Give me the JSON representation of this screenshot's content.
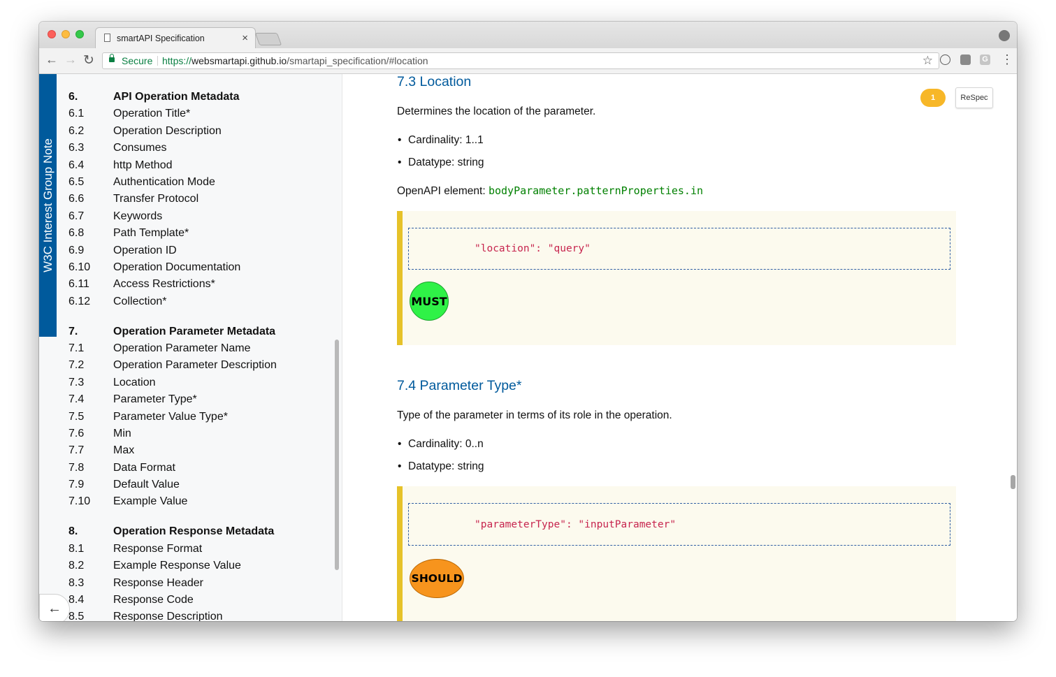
{
  "browser": {
    "tab_title": "smartAPI Specification",
    "tab_close": "×",
    "secure_label": "Secure",
    "url_scheme": "https://",
    "url_host": "websmartapi.github.io",
    "url_path": "/smartapi_specification/#location",
    "star": "☆",
    "back": "←",
    "forward": "→",
    "reload": "↻",
    "menu": "⋮",
    "ext_g": "G"
  },
  "sidebar": {
    "ribbon": "W3C Interest Group Note",
    "toggle": "←",
    "sections": [
      {
        "num": "6.",
        "label": "API Operation Metadata",
        "items": [
          {
            "num": "6.1",
            "label": "Operation Title*"
          },
          {
            "num": "6.2",
            "label": "Operation Description"
          },
          {
            "num": "6.3",
            "label": "Consumes"
          },
          {
            "num": "6.4",
            "label": "http Method"
          },
          {
            "num": "6.5",
            "label": "Authentication Mode"
          },
          {
            "num": "6.6",
            "label": "Transfer Protocol"
          },
          {
            "num": "6.7",
            "label": "Keywords"
          },
          {
            "num": "6.8",
            "label": "Path Template*"
          },
          {
            "num": "6.9",
            "label": "Operation ID"
          },
          {
            "num": "6.10",
            "label": "Operation Documentation"
          },
          {
            "num": "6.11",
            "label": "Access Restrictions*"
          },
          {
            "num": "6.12",
            "label": "Collection*"
          }
        ]
      },
      {
        "num": "7.",
        "label": "Operation Parameter Metadata",
        "items": [
          {
            "num": "7.1",
            "label": "Operation Parameter Name"
          },
          {
            "num": "7.2",
            "label": "Operation Parameter Description"
          },
          {
            "num": "7.3",
            "label": "Location"
          },
          {
            "num": "7.4",
            "label": "Parameter Type*"
          },
          {
            "num": "7.5",
            "label": "Parameter Value Type*"
          },
          {
            "num": "7.6",
            "label": "Min"
          },
          {
            "num": "7.7",
            "label": "Max"
          },
          {
            "num": "7.8",
            "label": "Data Format"
          },
          {
            "num": "7.9",
            "label": "Default Value"
          },
          {
            "num": "7.10",
            "label": "Example Value"
          }
        ]
      },
      {
        "num": "8.",
        "label": "Operation Response Metadata",
        "items": [
          {
            "num": "8.1",
            "label": "Response Format"
          },
          {
            "num": "8.2",
            "label": "Example Response Value"
          },
          {
            "num": "8.3",
            "label": "Response Header"
          },
          {
            "num": "8.4",
            "label": "Response Code"
          },
          {
            "num": "8.5",
            "label": "Response Description"
          }
        ]
      }
    ]
  },
  "respec": {
    "count": "1",
    "label": "ReSpec"
  },
  "content": {
    "location": {
      "heading": "7.3 Location",
      "description": "Determines the location of the parameter.",
      "cardinality": "Cardinality: 1..1",
      "datatype": "Datatype: string",
      "openapi_label": "OpenAPI element: ",
      "openapi_value": "bodyParameter.patternProperties.in",
      "example_code": "\"location\": \"query\"",
      "badge": "MUST"
    },
    "parameter_type": {
      "heading": "7.4 Parameter Type*",
      "description": "Type of the parameter in terms of its role in the operation.",
      "cardinality": "Cardinality: 0..n",
      "datatype": "Datatype: string",
      "example_code": "\"parameterType\": \"inputParameter\"",
      "badge": "SHOULD"
    }
  }
}
